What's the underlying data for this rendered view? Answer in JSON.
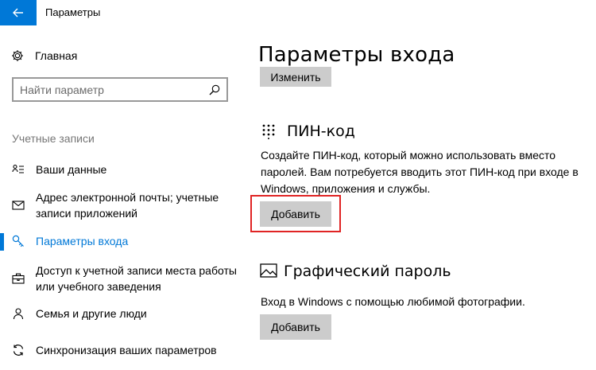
{
  "app_title": "Параметры",
  "sidebar": {
    "home_label": "Главная",
    "search_placeholder": "Найти параметр",
    "section_title": "Учетные записи",
    "items": [
      {
        "label": "Ваши данные",
        "icon": "person-card-icon",
        "selected": false
      },
      {
        "label": "Адрес электронной почты; учетные записи приложений",
        "icon": "mail-icon",
        "selected": false
      },
      {
        "label": "Параметры входа",
        "icon": "key-icon",
        "selected": true
      },
      {
        "label": "Доступ к учетной записи места работы или учебного заведения",
        "icon": "briefcase-icon",
        "selected": false
      },
      {
        "label": "Семья и другие люди",
        "icon": "people-icon",
        "selected": false
      },
      {
        "label": "Синхронизация ваших параметров",
        "icon": "sync-icon",
        "selected": false
      }
    ]
  },
  "main": {
    "page_title": "Параметры входа",
    "change_button": "Изменить",
    "pin": {
      "heading": "ПИН-код",
      "description": "Создайте ПИН-код, который можно использовать вместо паролей. Вам потребуется вводить этот ПИН-код при входе в Windows, приложения и службы.",
      "add_button": "Добавить"
    },
    "picture_password": {
      "heading": "Графический пароль",
      "description": "Вход в Windows с помощью любимой фотографии.",
      "add_button": "Добавить"
    }
  },
  "colors": {
    "accent": "#0078d7",
    "highlight": "#e02424",
    "button": "#cccccc"
  }
}
